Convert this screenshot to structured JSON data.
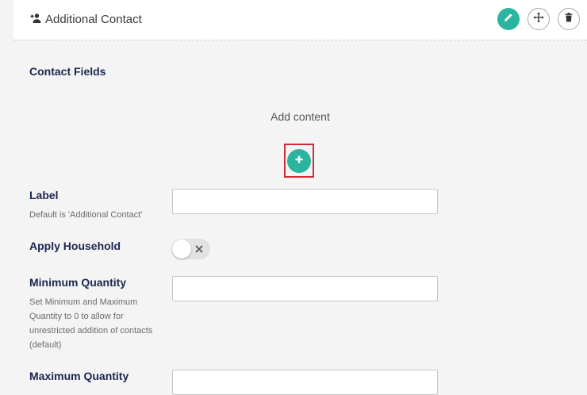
{
  "header": {
    "title": "Additional Contact",
    "icons": [
      "add-person-icon",
      "pencil-icon",
      "move-arrows-icon",
      "trash-icon"
    ]
  },
  "content": {
    "section_title": "Contact Fields",
    "add_content_label": "Add content",
    "add_button_icon": "plus-icon"
  },
  "fields": {
    "label": {
      "label": "Label",
      "description": "Default is 'Additional Contact'",
      "value": ""
    },
    "apply_household": {
      "label": "Apply Household",
      "enabled": false
    },
    "minimum_quantity": {
      "label": "Minimum Quantity",
      "description": "Set Minimum and Maximum Quantity to 0 to allow for unrestricted addition of contacts (default)",
      "value": ""
    },
    "maximum_quantity": {
      "label": "Maximum Quantity",
      "value": ""
    }
  },
  "colors": {
    "accent": "#2bb5a0",
    "highlight": "#d42a36",
    "label_text": "#1b264f",
    "background": "#f4f4f4"
  }
}
